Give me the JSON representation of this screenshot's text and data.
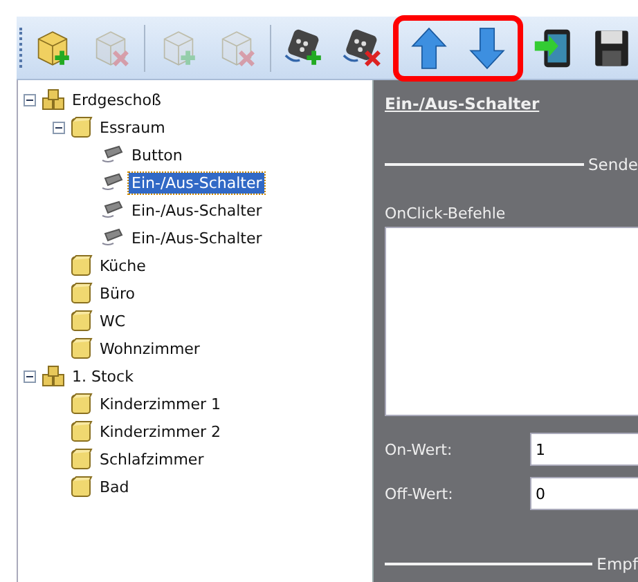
{
  "toolbar": {
    "groups": [
      {
        "highlighted": false,
        "buttons": [
          {
            "kind": "floor-add",
            "disabled": false
          },
          {
            "kind": "floor-remove",
            "disabled": true
          }
        ]
      },
      {
        "highlighted": false,
        "buttons": [
          {
            "kind": "room-add",
            "disabled": true
          },
          {
            "kind": "room-remove",
            "disabled": true
          }
        ]
      },
      {
        "highlighted": false,
        "buttons": [
          {
            "kind": "device-add",
            "disabled": false
          },
          {
            "kind": "device-remove",
            "disabled": false
          }
        ]
      },
      {
        "highlighted": true,
        "buttons": [
          {
            "kind": "move-up",
            "disabled": false
          },
          {
            "kind": "move-down",
            "disabled": false
          }
        ]
      },
      {
        "highlighted": false,
        "buttons": [
          {
            "kind": "export",
            "disabled": false
          },
          {
            "kind": "save",
            "disabled": false
          }
        ]
      }
    ]
  },
  "tree": [
    {
      "label": "Erdgeschoß",
      "kind": "floor",
      "expanded": true,
      "selected": false,
      "children": [
        {
          "label": "Essraum",
          "kind": "room",
          "expanded": true,
          "selected": false,
          "children": [
            {
              "label": "Button",
              "kind": "device",
              "selected": false
            },
            {
              "label": "Ein-/Aus-Schalter",
              "kind": "device",
              "selected": true
            },
            {
              "label": "Ein-/Aus-Schalter",
              "kind": "device",
              "selected": false
            },
            {
              "label": "Ein-/Aus-Schalter",
              "kind": "device",
              "selected": false
            }
          ]
        },
        {
          "label": "Küche",
          "kind": "room",
          "selected": false
        },
        {
          "label": "Büro",
          "kind": "room",
          "selected": false
        },
        {
          "label": "WC",
          "kind": "room",
          "selected": false
        },
        {
          "label": "Wohnzimmer",
          "kind": "room",
          "selected": false
        }
      ]
    },
    {
      "label": "1. Stock",
      "kind": "floor",
      "expanded": true,
      "selected": false,
      "children": [
        {
          "label": "Kinderzimmer 1",
          "kind": "room",
          "selected": false
        },
        {
          "label": "Kinderzimmer 2",
          "kind": "room",
          "selected": false
        },
        {
          "label": "Schlafzimmer",
          "kind": "room",
          "selected": false
        },
        {
          "label": "Bad",
          "kind": "room",
          "selected": false
        }
      ]
    }
  ],
  "details": {
    "title": "Ein-/Aus-Schalter",
    "send_section": "Sende",
    "commands_label": "OnClick-Befehle",
    "fields": [
      {
        "label": "On-Wert:",
        "value": "1"
      },
      {
        "label": "Off-Wert:",
        "value": "0"
      }
    ],
    "receive_section": "Empf"
  }
}
